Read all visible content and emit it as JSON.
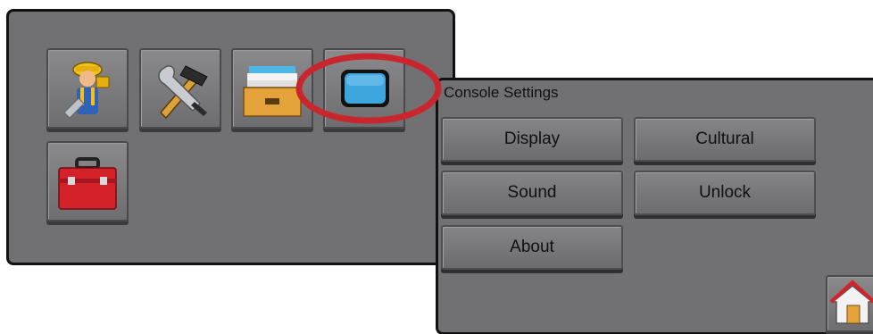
{
  "console_settings": {
    "title": "Console Settings",
    "buttons": {
      "display": "Display",
      "cultural": "Cultural",
      "sound": "Sound",
      "unlock": "Unlock",
      "about": "About"
    }
  },
  "icons": {
    "tile_1": "user-setup-icon",
    "tile_2": "tools-icon",
    "tile_3": "data-management-icon",
    "tile_4": "console-icon",
    "tile_5": "toolbox-icon",
    "home": "home-icon"
  },
  "colors": {
    "panel": "#717073",
    "highlight": "#c8262c",
    "console_screen": "#3ea6de"
  }
}
